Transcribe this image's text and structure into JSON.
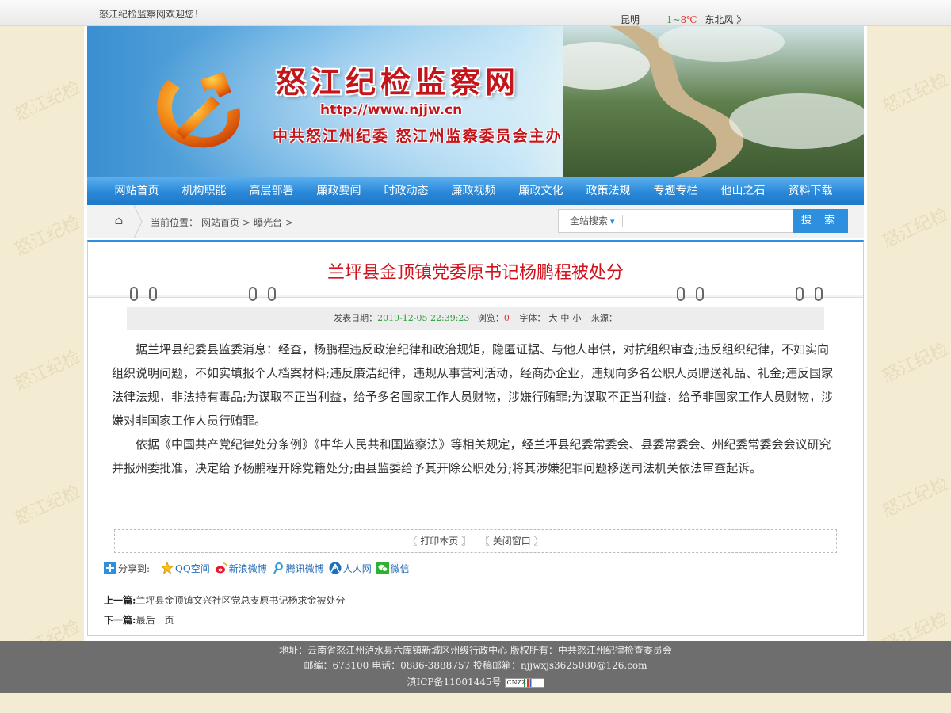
{
  "watermark": "怒江纪检",
  "topbar": {
    "welcome": "怒江纪检监察网欢迎您！",
    "city": "昆明",
    "temp_low": "1",
    "temp_sep": "~",
    "temp_high": "8℃",
    "wind": "东北风 》"
  },
  "banner": {
    "title": "怒江纪检监察网",
    "url": "http://www.njjw.cn",
    "host": "中共怒江州纪委 怒江州监察委员会主办"
  },
  "nav": {
    "items": [
      "网站首页",
      "机构职能",
      "高层部署",
      "廉政要闻",
      "时政动态",
      "廉政视频",
      "廉政文化",
      "政策法规",
      "专题专栏",
      "他山之石",
      "资料下载"
    ]
  },
  "crumb": {
    "prefix": "当前位置：",
    "items": [
      "网站首页",
      "曝光台"
    ],
    "sep": ">"
  },
  "search": {
    "scope": "全站搜索",
    "placeholder": "",
    "button": "搜 索"
  },
  "article": {
    "title": "兰坪县金顶镇党委原书记杨鹏程被处分",
    "date_label": "发表日期：",
    "date": "2019-12-05 22:39:23",
    "views_label": "浏览：",
    "views": "0",
    "font_label": "字体：",
    "font_sizes": [
      "大",
      "中",
      "小"
    ],
    "source_label": "来源：",
    "paragraphs": [
      "据兰坪县纪委县监委消息：经查，杨鹏程违反政治纪律和政治规矩，隐匿证据、与他人串供，对抗组织审查;违反组织纪律，不如实向组织说明问题，不如实填报个人档案材料;违反廉洁纪律，违规从事营利活动，经商办企业，违规向多名公职人员赠送礼品、礼金;违反国家法律法规，非法持有毒品;为谋取不正当利益，给予多名国家工作人员财物，涉嫌行贿罪;为谋取不正当利益，给予非国家工作人员财物，涉嫌对非国家工作人员行贿罪。",
      "依据《中国共产党纪律处分条例》《中华人民共和国监察法》等相关规定，经兰坪县纪委常委会、县委常委会、州纪委常委会会议研究并报州委批准，决定给予杨鹏程开除党籍处分;由县监委给予其开除公职处分;将其涉嫌犯罪问题移送司法机关依法审查起诉。"
    ],
    "print": "〖 打印本页 〗",
    "close": "〖 关闭窗口 〗"
  },
  "share": {
    "label": "分享到:",
    "items": [
      "QQ空间",
      "新浪微博",
      "腾讯微博",
      "人人网",
      "微信"
    ]
  },
  "prevnext": {
    "prev_label": "上一篇:",
    "prev": "兰坪县金顶镇文兴社区党总支原书记杨求金被处分",
    "next_label": "下一篇:",
    "next": "最后一页"
  },
  "footer": {
    "line1": "地址：云南省怒江州泸水县六库镇新城区州级行政中心 版权所有：中共怒江州纪律检查委员会",
    "line2": "邮编：673100 电话：0886-3888757 投稿邮箱：njjwxjs3625080@126.com",
    "line3": "滇ICP备11001445号",
    "badge": "CNZZ"
  }
}
